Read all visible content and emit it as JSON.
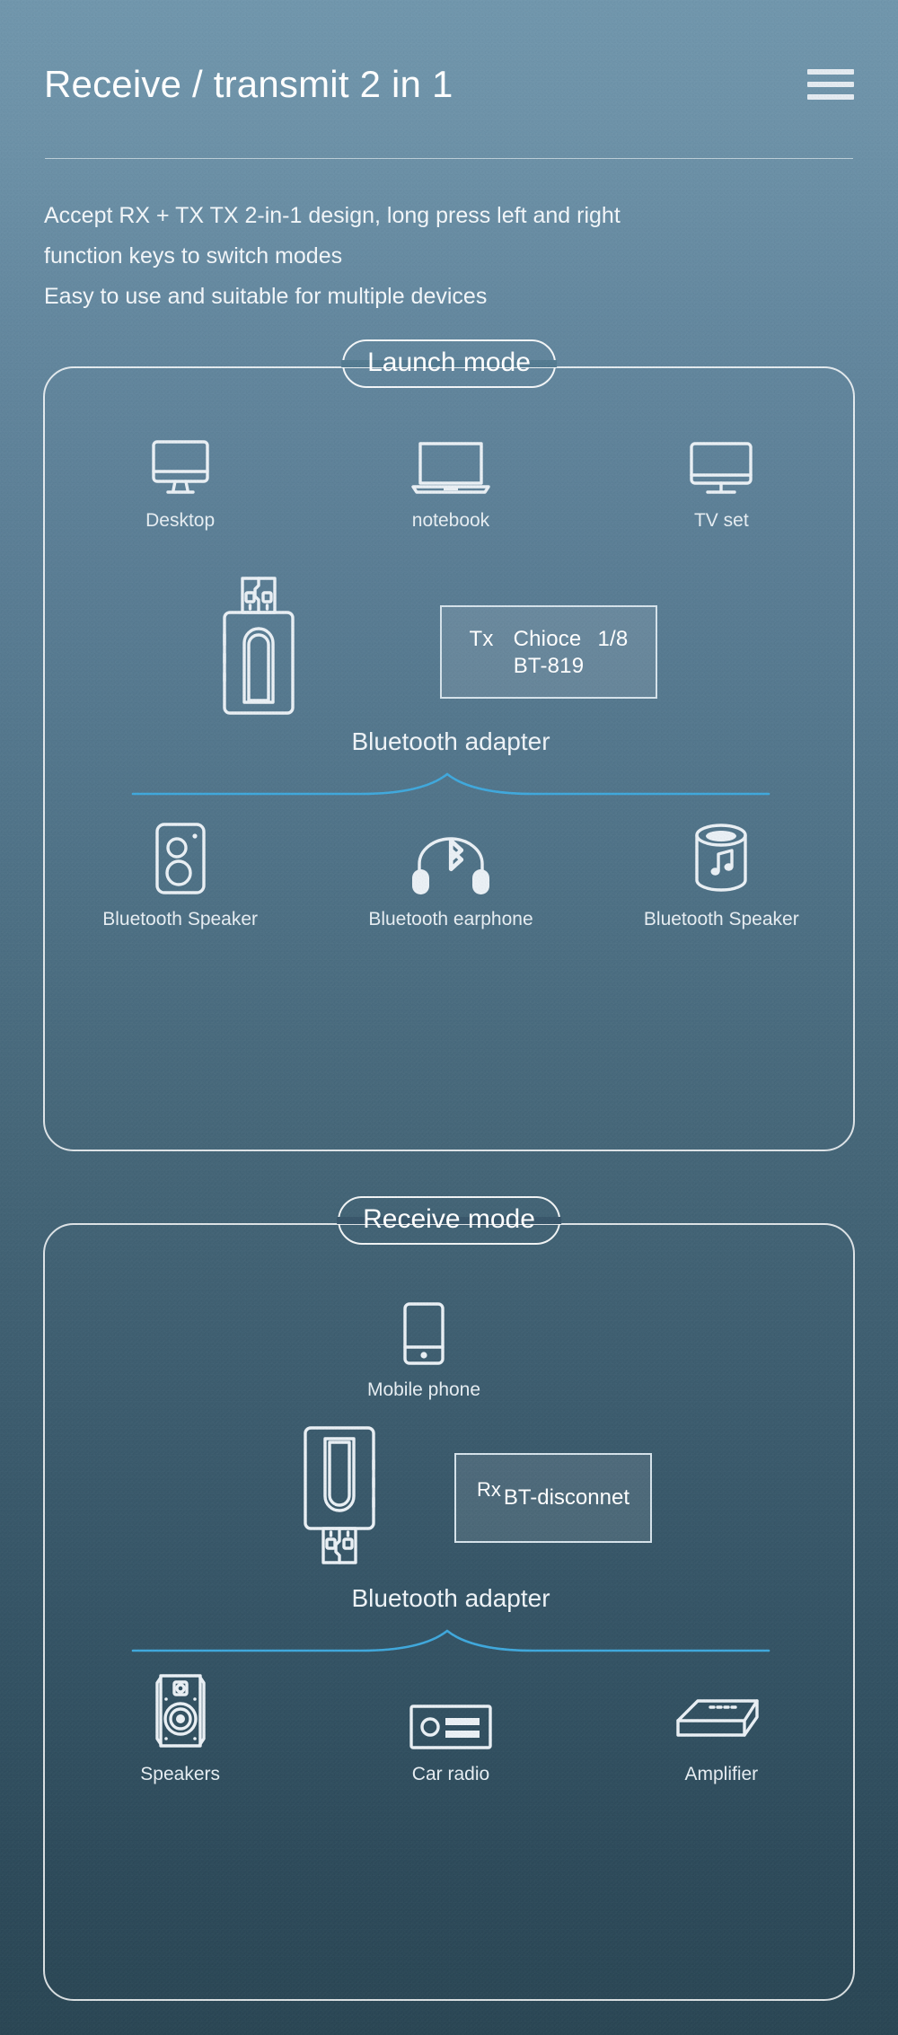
{
  "header": {
    "title": "Receive / transmit 2 in 1",
    "menu_icon": "hamburger-menu-icon",
    "description_lines": [
      "Accept RX + TX TX 2-in-1 design, long press left and right",
      "function keys to switch modes",
      "Easy to use and suitable for multiple devices"
    ]
  },
  "colors": {
    "background_top": "#7096ac",
    "background_bottom": "#2a4654",
    "text": "#ffffff",
    "accent_wave": "#3fa8dc",
    "outline": "#e9eff4"
  },
  "launch_mode": {
    "pill_label": "Launch mode",
    "sources": [
      {
        "label": "Desktop",
        "icon": "desktop-monitor-icon"
      },
      {
        "label": "notebook",
        "icon": "laptop-icon"
      },
      {
        "label": "TV set",
        "icon": "tv-icon"
      }
    ],
    "adapter": {
      "icon": "usb-bluetooth-adapter-icon",
      "caption": "Bluetooth adapter",
      "display": {
        "mode_tag": "Tx",
        "line1_middle": "Chioce",
        "line1_right": "1/8",
        "line2": "BT-819"
      }
    },
    "targets": [
      {
        "label": "Bluetooth Speaker",
        "icon": "bookshelf-speaker-icon"
      },
      {
        "label": "Bluetooth earphone",
        "icon": "bluetooth-headphones-icon"
      },
      {
        "label": "Bluetooth Speaker",
        "icon": "cylinder-smart-speaker-icon"
      }
    ]
  },
  "receive_mode": {
    "pill_label": "Receive mode",
    "sources": [
      {
        "label": "Mobile phone",
        "icon": "mobile-phone-icon"
      }
    ],
    "adapter": {
      "icon": "usb-bluetooth-adapter-flipped-icon",
      "caption": "Bluetooth adapter",
      "display": {
        "mode_tag": "Rx",
        "status": "BT-disconnet"
      }
    },
    "targets": [
      {
        "label": "Speakers",
        "icon": "studio-speaker-icon"
      },
      {
        "label": "Car radio",
        "icon": "car-stereo-icon"
      },
      {
        "label": "Amplifier",
        "icon": "amplifier-box-icon"
      }
    ]
  }
}
